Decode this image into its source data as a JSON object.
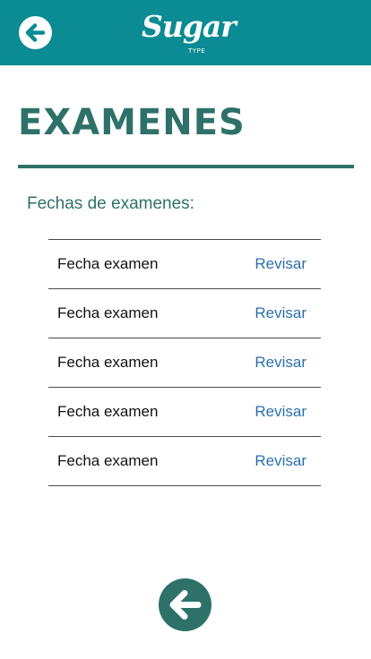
{
  "header": {
    "back_icon": "arrow-left-circle-icon",
    "logo_text": "Sugar",
    "logo_subtext": "TYPE"
  },
  "page": {
    "title": "EXAMENES",
    "section_label": "Fechas de examenes:"
  },
  "exams": [
    {
      "date_label": "Fecha examen",
      "action_label": "Revisar"
    },
    {
      "date_label": "Fecha examen",
      "action_label": "Revisar"
    },
    {
      "date_label": "Fecha examen",
      "action_label": "Revisar"
    },
    {
      "date_label": "Fecha examen",
      "action_label": "Revisar"
    },
    {
      "date_label": "Fecha examen",
      "action_label": "Revisar"
    }
  ],
  "footer": {
    "back_icon": "arrow-left-circle-icon"
  },
  "colors": {
    "header_bg": "#0b8b93",
    "primary": "#2e7169",
    "link": "#2a6fad"
  }
}
